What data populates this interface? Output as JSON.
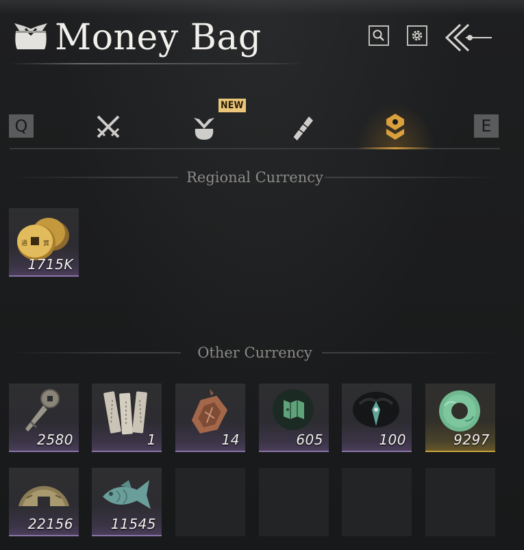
{
  "header": {
    "title": "Money Bag",
    "icons": [
      "money-bag-icon",
      "search-icon",
      "settings-gear-icon",
      "back-arrow-icon"
    ]
  },
  "tabs": {
    "prev_key": "Q",
    "next_key": "E",
    "new_badge": "NEW",
    "items": [
      "crossed-swords-icon",
      "bundle-icon",
      "scroll-icon",
      "currency-icon"
    ],
    "active_index": 3
  },
  "sections": {
    "regional_title": "Regional Currency",
    "other_title": "Other Currency"
  },
  "regional_items": [
    {
      "name": "copper-coins",
      "qty": "1715K",
      "rarity": "purple"
    }
  ],
  "other_items": [
    {
      "name": "coin-sword",
      "qty": "2580",
      "rarity": "purple"
    },
    {
      "name": "paper-notes",
      "qty": "1",
      "rarity": "purple"
    },
    {
      "name": "bronze-token",
      "qty": "14",
      "rarity": "purple"
    },
    {
      "name": "jade-map",
      "qty": "605",
      "rarity": "purple"
    },
    {
      "name": "dark-emblem",
      "qty": "100",
      "rarity": "purple"
    },
    {
      "name": "jade-ring",
      "qty": "9297",
      "rarity": "gold"
    },
    {
      "name": "half-coin",
      "qty": "22156",
      "rarity": "purple"
    },
    {
      "name": "jade-fish",
      "qty": "11545",
      "rarity": "purple"
    }
  ],
  "colors": {
    "accent": "#d9a03c",
    "rarity_purple": "#8a74a8",
    "rarity_gold": "#c9a53e",
    "background": "#1a1b1c"
  }
}
